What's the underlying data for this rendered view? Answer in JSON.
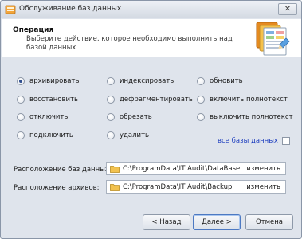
{
  "window": {
    "title": "Обслуживание баз данных",
    "close_glyph": "✕"
  },
  "header": {
    "title": "Операция",
    "description": "Выберите действие, которое необходимо выполнить над базой данных"
  },
  "operations": [
    {
      "label": "архивировать",
      "checked": true
    },
    {
      "label": "индексировать",
      "checked": false
    },
    {
      "label": "обновить",
      "checked": false
    },
    {
      "label": "восстановить",
      "checked": false
    },
    {
      "label": "дефрагментировать",
      "checked": false
    },
    {
      "label": "включить полнотекст",
      "checked": false
    },
    {
      "label": "отключить",
      "checked": false
    },
    {
      "label": "обрезать",
      "checked": false
    },
    {
      "label": "выключить полнотекст",
      "checked": false
    },
    {
      "label": "подключить",
      "checked": false
    },
    {
      "label": "удалить",
      "checked": false
    }
  ],
  "all_databases": {
    "label": "все базы данных",
    "checked": false
  },
  "db_location": {
    "label": "Расположение баз данных:",
    "path": "C:\\ProgramData\\IT Audit\\DataBase",
    "change_label": "изменить"
  },
  "archive_location": {
    "label": "Расположение архивов:",
    "path": "C:\\ProgramData\\IT Audit\\Backup",
    "change_label": "изменить"
  },
  "buttons": {
    "back": "< Назад",
    "next": "Далее >",
    "cancel": "Отмена"
  },
  "colors": {
    "link": "#1f3fbf",
    "window_bg": "#dfe4ec",
    "radio_dot": "#2f4e8f"
  }
}
